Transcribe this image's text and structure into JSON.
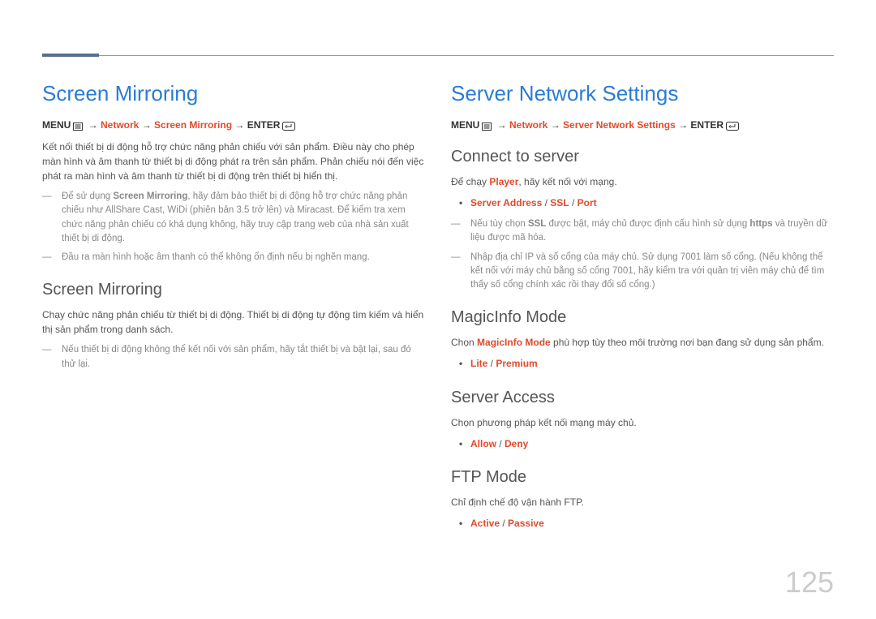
{
  "pageNumber": "125",
  "left": {
    "title": "Screen Mirroring",
    "breadcrumb": {
      "parts": [
        {
          "text": "MENU",
          "style": "bold"
        },
        {
          "text": "m",
          "style": "icon-menu"
        },
        {
          "text": " → ",
          "style": "bold"
        },
        {
          "text": "Network",
          "style": "red"
        },
        {
          "text": " → ",
          "style": "bold"
        },
        {
          "text": "Screen Mirroring",
          "style": "red"
        },
        {
          "text": " → ",
          "style": "bold"
        },
        {
          "text": "ENTER",
          "style": "bold"
        },
        {
          "text": "E",
          "style": "icon-enter"
        }
      ]
    },
    "intro": "Kết nối thiết bị di động hỗ trợ chức năng phản chiếu với sản phẩm. Điều này cho phép màn hình và âm thanh từ thiết bị di động phát ra trên sản phẩm. Phản chiếu nói đến việc phát ra màn hình và âm thanh từ thiết bị di động trên thiết bị hiển thị.",
    "notes": [
      {
        "runs": [
          {
            "t": "Để sử dụng "
          },
          {
            "t": "Screen Mirroring",
            "s": "bold"
          },
          {
            "t": ", hãy đảm bảo thiết bị di động hỗ trợ chức năng phản chiếu như AllShare Cast, WiDi (phiên bản 3.5 trở lên) và Miracast. Để kiểm tra xem chức năng phản chiếu có khả dụng không, hãy truy cập trang web của nhà sản xuất thiết bị di động."
          }
        ]
      },
      {
        "runs": [
          {
            "t": "Đầu ra màn hình hoặc âm thanh có thể không ổn định nếu bị nghẽn mạng."
          }
        ]
      }
    ],
    "section1": {
      "heading": "Screen Mirroring",
      "text": "Chạy chức năng phản chiếu từ thiết bị di động. Thiết bị di động tự động tìm kiếm và hiển thị sản phẩm trong danh sách.",
      "notes": [
        {
          "runs": [
            {
              "t": "Nếu thiết bị di động không thể kết nối với sản phẩm, hãy tắt thiết bị và bật lại, sau đó thử lại."
            }
          ]
        }
      ]
    }
  },
  "right": {
    "title": "Server Network Settings",
    "breadcrumb": {
      "parts": [
        {
          "text": "MENU",
          "style": "bold"
        },
        {
          "text": "m",
          "style": "icon-menu"
        },
        {
          "text": " → ",
          "style": "bold"
        },
        {
          "text": "Network",
          "style": "red"
        },
        {
          "text": " → ",
          "style": "bold"
        },
        {
          "text": "Server Network Settings",
          "style": "red"
        },
        {
          "text": " → ",
          "style": "bold"
        },
        {
          "text": "ENTER",
          "style": "bold"
        },
        {
          "text": "E",
          "style": "icon-enter"
        }
      ]
    },
    "connect": {
      "heading": "Connect to server",
      "text_runs": [
        {
          "t": "Để chạy "
        },
        {
          "t": "Player",
          "s": "red"
        },
        {
          "t": ", hãy kết nối với mạng."
        }
      ],
      "bullet_runs": [
        {
          "t": "Server Address",
          "s": "red"
        },
        {
          "t": " / "
        },
        {
          "t": "SSL",
          "s": "red"
        },
        {
          "t": " / "
        },
        {
          "t": "Port",
          "s": "red"
        }
      ],
      "notes": [
        {
          "runs": [
            {
              "t": "Nếu tùy chọn "
            },
            {
              "t": "SSL",
              "s": "bold"
            },
            {
              "t": " được bật, máy chủ được định cấu hình sử dụng "
            },
            {
              "t": "https",
              "s": "bold"
            },
            {
              "t": " và truyền dữ liệu được mã hóa."
            }
          ]
        },
        {
          "runs": [
            {
              "t": "Nhập địa chỉ IP và số cổng của máy chủ. Sử dụng 7001 làm số cổng. (Nếu không thể kết nối với máy chủ bằng số cổng 7001, hãy kiểm tra với quản trị viên máy chủ để tìm thấy số cổng chính xác rồi thay đổi số cổng.)"
            }
          ]
        }
      ]
    },
    "magic": {
      "heading": "MagicInfo Mode",
      "text_runs": [
        {
          "t": "Chọn "
        },
        {
          "t": "MagicInfo Mode",
          "s": "red"
        },
        {
          "t": " phù hợp tùy theo môi trường nơi bạn đang sử dụng sản phẩm."
        }
      ],
      "bullet_runs": [
        {
          "t": "Lite",
          "s": "red"
        },
        {
          "t": " / "
        },
        {
          "t": "Premium",
          "s": "red"
        }
      ]
    },
    "access": {
      "heading": "Server Access",
      "text": "Chọn phương pháp kết nối mạng máy chủ.",
      "bullet_runs": [
        {
          "t": "Allow",
          "s": "red"
        },
        {
          "t": " / "
        },
        {
          "t": "Deny",
          "s": "red"
        }
      ]
    },
    "ftp": {
      "heading": "FTP Mode",
      "text": "Chỉ định chế độ vận hành FTP.",
      "bullet_runs": [
        {
          "t": "Active",
          "s": "red"
        },
        {
          "t": " / "
        },
        {
          "t": "Passive",
          "s": "red"
        }
      ]
    }
  }
}
